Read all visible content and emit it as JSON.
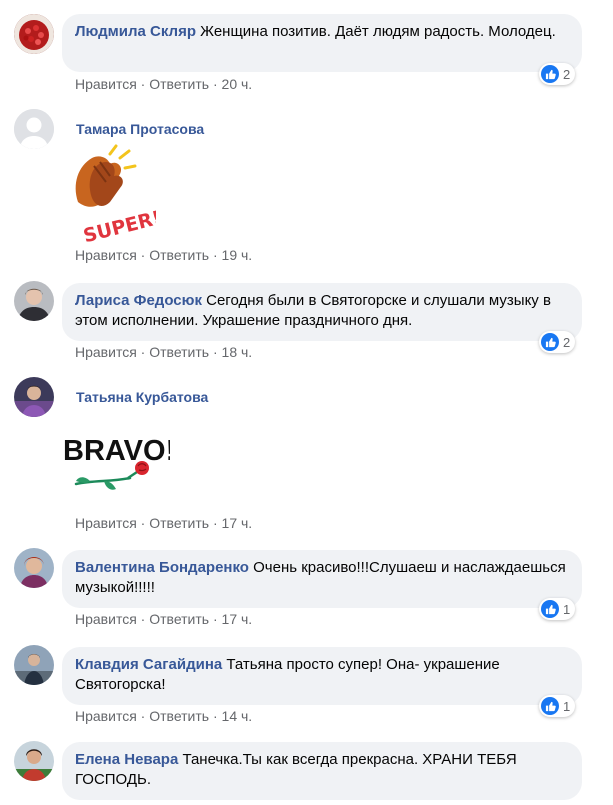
{
  "actions": {
    "like": "Нравится",
    "reply": "Ответить",
    "sep": " · "
  },
  "comments": [
    {
      "author": "Людмила Скляр",
      "text": "Женщина позитив. Даёт людям радость. Молодец.",
      "time": "20 ч.",
      "likes": "2"
    },
    {
      "author": "Тамара Протасова",
      "sticker": "super-clap-sticker",
      "time": "19 ч."
    },
    {
      "author": "Лариса Федосюк",
      "text": "Сегодня были в Святогорске и слушали музыку в этом исполнении. Украшение праздничного дня.",
      "time": "18 ч.",
      "likes": "2"
    },
    {
      "author": "Татьяна Курбатова",
      "sticker": "bravo-rose-sticker",
      "time": "17 ч."
    },
    {
      "author": "Валентина Бондаренко",
      "text": "Очень красиво!!!Слушаеш и наслаждаешься музыкой!!!!!",
      "time": "17 ч.",
      "likes": "1"
    },
    {
      "author": "Клавдия Сагайдина",
      "text": "Татьяна просто супер! Она- украшение Святогорска!",
      "time": "14 ч.",
      "likes": "1"
    },
    {
      "author": "Елена Невара",
      "text": "Танечка.Ты как всегда прекрасна. ХРАНИ ТЕБЯ ГОСПОДЬ."
    }
  ],
  "stickers": {
    "super_text": "SUPER!",
    "bravo_text": "BRAVO!"
  },
  "colors": {
    "name": "#385898",
    "bubble": "#f0f2f5",
    "meta": "#65676b",
    "like": "#1877f2"
  }
}
